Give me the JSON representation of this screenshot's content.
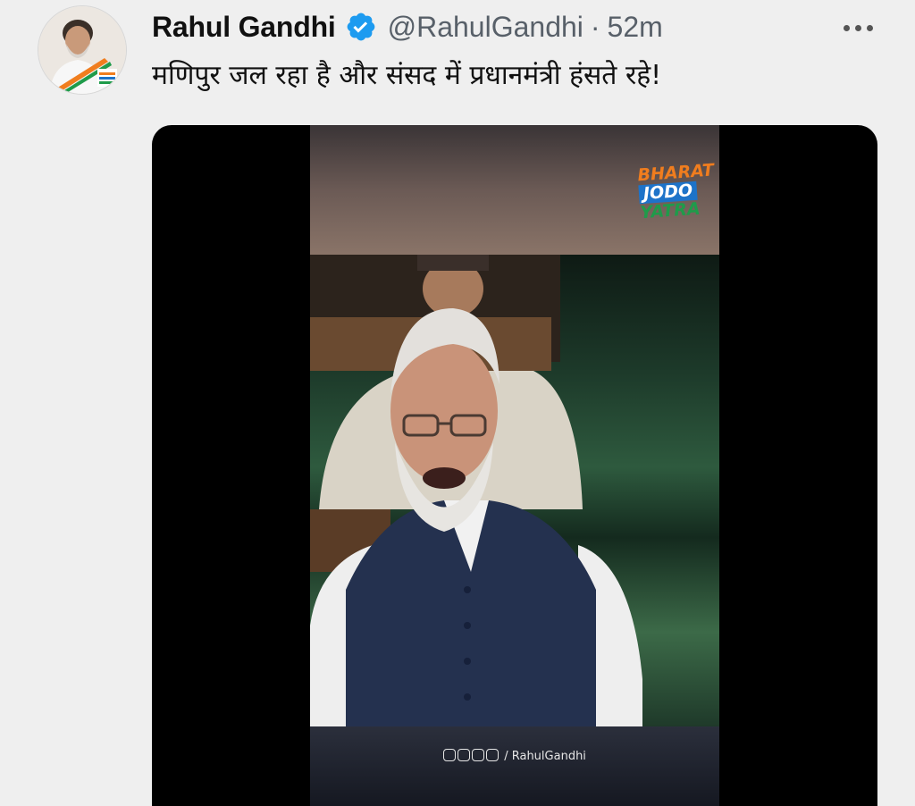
{
  "tweet": {
    "author": {
      "display_name": "Rahul Gandhi",
      "handle": "@RahulGandhi",
      "verified": true,
      "avatar_icon": "profile-photo"
    },
    "separator": "·",
    "time": "52m",
    "text": "मणिपुर जल रहा है और संसद में प्रधानमंत्री हंसते रहे!",
    "more_icon": "more-horizontal-icon"
  },
  "media": {
    "type": "video",
    "logo": {
      "line1": "BHARAT",
      "line2": "JODO",
      "line3": "YATRA"
    },
    "credit": "/ RahulGandhi"
  },
  "colors": {
    "verified_blue": "#1d9bf0",
    "handle_gray": "#586069",
    "background": "#efefef"
  }
}
